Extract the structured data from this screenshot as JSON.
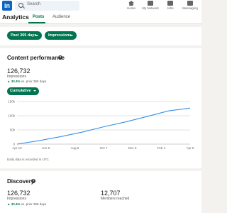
{
  "topnav": {
    "logo": "in",
    "search_placeholder": "Search",
    "items": [
      {
        "label": "Home",
        "icon": "home-icon"
      },
      {
        "label": "My Network",
        "icon": "network-icon"
      },
      {
        "label": "Jobs",
        "icon": "jobs-icon"
      },
      {
        "label": "Messaging",
        "icon": "messaging-icon"
      }
    ]
  },
  "subbar": {
    "title": "Analytics",
    "tabs": [
      {
        "label": "Posts",
        "active": true
      },
      {
        "label": "Audience",
        "active": false
      }
    ]
  },
  "filters": {
    "range": "Past 365 days",
    "metric": "Impressions"
  },
  "content": {
    "title": "Content performance",
    "value": "126,732",
    "label": "Impressions",
    "delta_pct": "▲ 33.4%",
    "delta_text": "vs. prior 365 days",
    "mode": "Cumulative",
    "note": "Daily data is recorded in UTC"
  },
  "chart_data": {
    "type": "line",
    "x": [
      "Apr 10",
      "Jun 9",
      "Aug 8",
      "Oct 7",
      "Dec 6",
      "Feb 4",
      "Apr 5"
    ],
    "series": [
      {
        "values": [
          0,
          12000,
          26000,
          42000,
          61000,
          78000,
          97000,
          117000,
          126732
        ]
      }
    ],
    "yticks": [
      "150k",
      "100k",
      "50k",
      "0"
    ],
    "ylim": [
      0,
      150000
    ],
    "grid": true,
    "color": "#378fe9"
  },
  "discovery": {
    "title": "Discovery",
    "impressions_value": "126,732",
    "impressions_label": "Impressions",
    "delta_pct": "▲ 33.4%",
    "delta_text": "vs. prior 365 days",
    "members_value": "12,707",
    "members_label": "Members reached"
  }
}
